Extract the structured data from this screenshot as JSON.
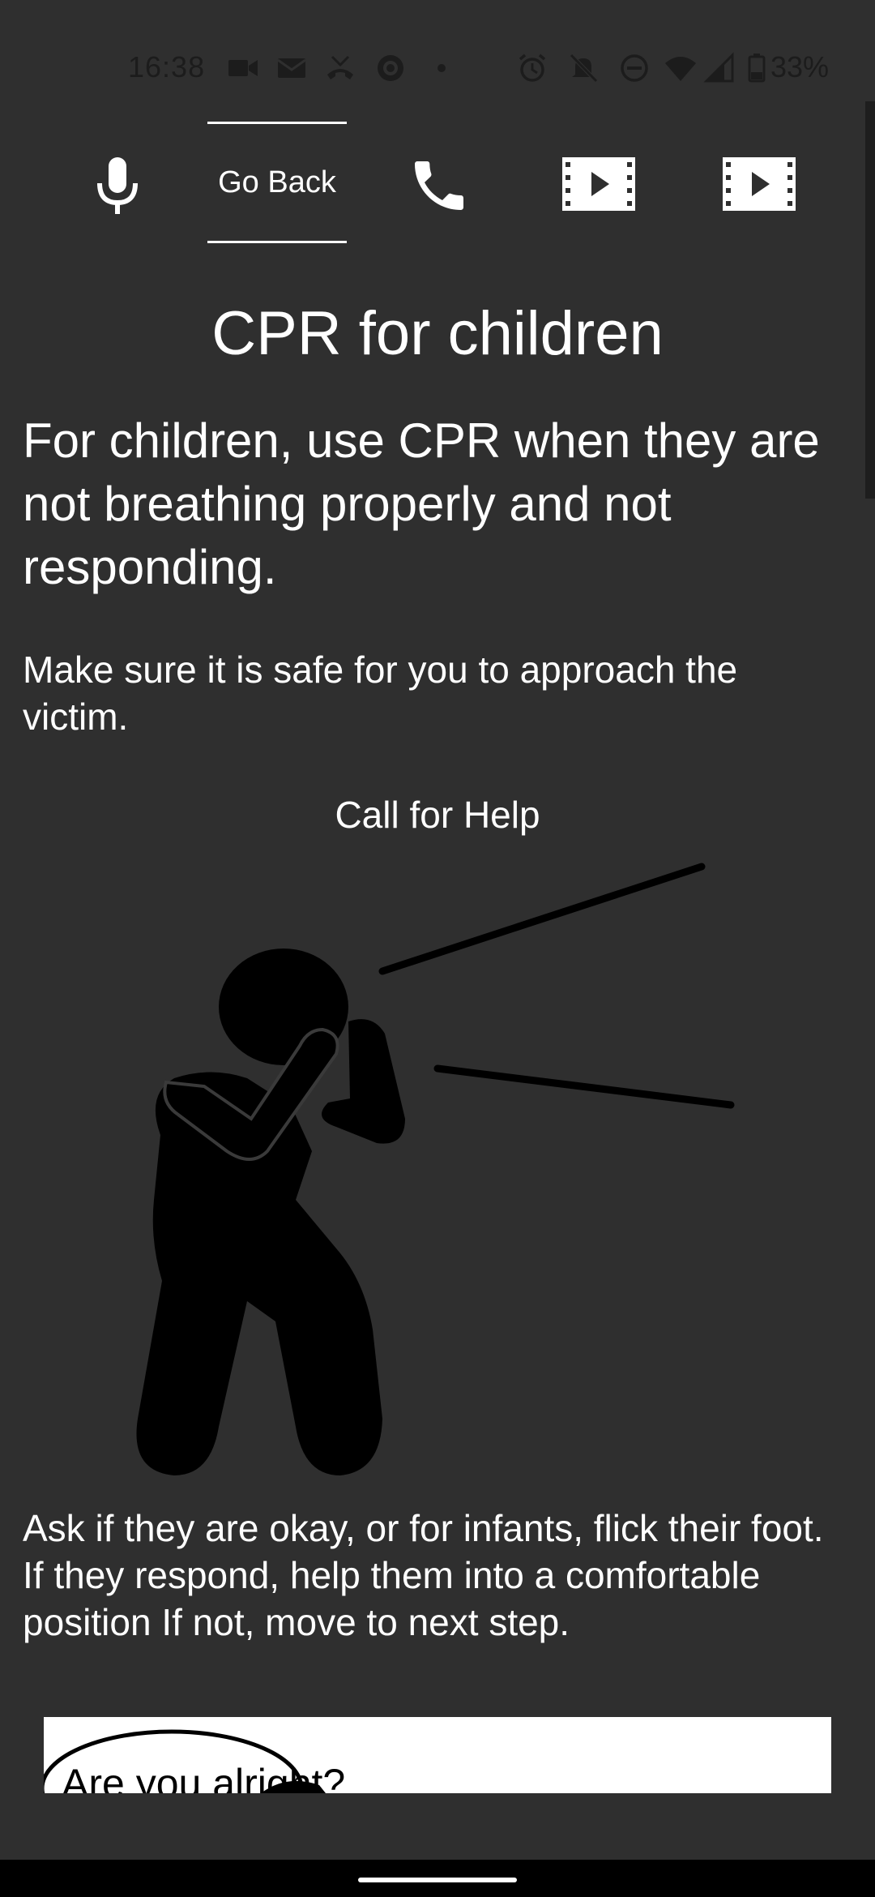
{
  "status_bar": {
    "time": "16:38",
    "battery_percent": "33%",
    "icons": [
      "video-call-icon",
      "mail-icon",
      "missed-call-icon",
      "media-icon",
      "dot-icon",
      "alarm-icon",
      "mute-icon",
      "dnd-icon",
      "wifi-icon",
      "signal-icon",
      "battery-icon"
    ]
  },
  "toolbar": {
    "mic_icon": "microphone-icon",
    "go_back_label": "Go Back",
    "call_icon": "phone-icon",
    "video1_icon": "video-play-icon",
    "video2_icon": "video-play-icon"
  },
  "content": {
    "title": "CPR for children",
    "lead": "For children, use CPR when they are not breathing properly and not responding.",
    "para1": "Make sure it is safe for you to approach the victim.",
    "step_heading": "Call for Help",
    "para2": "Ask if they are okay, or for infants, flick their foot. If they respond, help them into a comfortable position If not, move to next step.",
    "next_image_text": "Are you alright?"
  },
  "colors": {
    "background": "#2f2f2f",
    "text": "#ffffff",
    "icon": "#ffffff",
    "figure": "#000000",
    "status_text": "#1c1c1c"
  }
}
